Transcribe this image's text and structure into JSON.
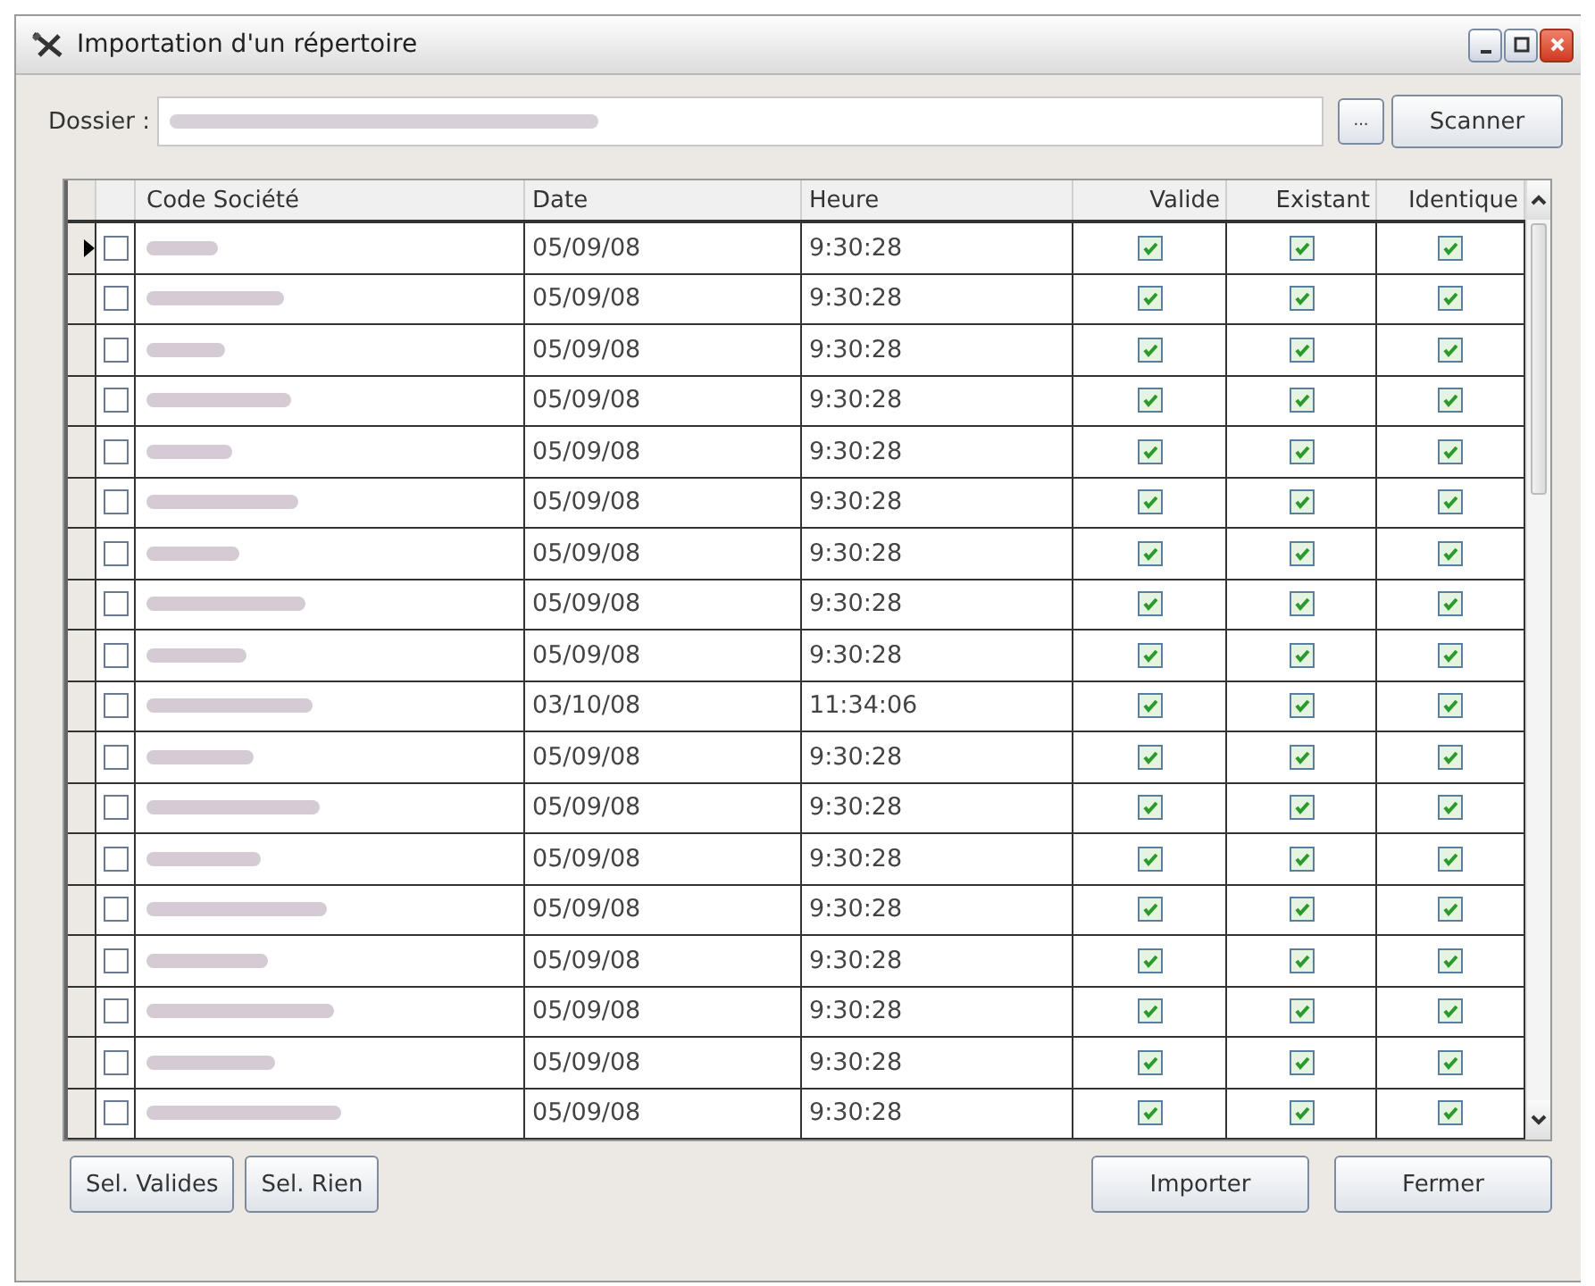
{
  "window": {
    "title": "Importation d'un répertoire"
  },
  "folder": {
    "label": "Dossier :",
    "browse_label": "...",
    "scan_label": "Scanner"
  },
  "table": {
    "columns": [
      "Code Société",
      "Date",
      "Heure",
      "Valide",
      "Existant",
      "Identique"
    ],
    "rows": [
      {
        "current": true,
        "checked": false,
        "date": "05/09/08",
        "time": "9:30:28",
        "valid": true,
        "existing": true,
        "identical": true
      },
      {
        "current": false,
        "checked": false,
        "date": "05/09/08",
        "time": "9:30:28",
        "valid": true,
        "existing": true,
        "identical": true
      },
      {
        "current": false,
        "checked": false,
        "date": "05/09/08",
        "time": "9:30:28",
        "valid": true,
        "existing": true,
        "identical": true
      },
      {
        "current": false,
        "checked": false,
        "date": "05/09/08",
        "time": "9:30:28",
        "valid": true,
        "existing": true,
        "identical": true
      },
      {
        "current": false,
        "checked": false,
        "date": "05/09/08",
        "time": "9:30:28",
        "valid": true,
        "existing": true,
        "identical": true
      },
      {
        "current": false,
        "checked": false,
        "date": "05/09/08",
        "time": "9:30:28",
        "valid": true,
        "existing": true,
        "identical": true
      },
      {
        "current": false,
        "checked": false,
        "date": "05/09/08",
        "time": "9:30:28",
        "valid": true,
        "existing": true,
        "identical": true
      },
      {
        "current": false,
        "checked": false,
        "date": "05/09/08",
        "time": "9:30:28",
        "valid": true,
        "existing": true,
        "identical": true
      },
      {
        "current": false,
        "checked": false,
        "date": "05/09/08",
        "time": "9:30:28",
        "valid": true,
        "existing": true,
        "identical": true
      },
      {
        "current": false,
        "checked": false,
        "date": "03/10/08",
        "time": "11:34:06",
        "valid": true,
        "existing": true,
        "identical": true
      },
      {
        "current": false,
        "checked": false,
        "date": "05/09/08",
        "time": "9:30:28",
        "valid": true,
        "existing": true,
        "identical": true
      },
      {
        "current": false,
        "checked": false,
        "date": "05/09/08",
        "time": "9:30:28",
        "valid": true,
        "existing": true,
        "identical": true
      },
      {
        "current": false,
        "checked": false,
        "date": "05/09/08",
        "time": "9:30:28",
        "valid": true,
        "existing": true,
        "identical": true
      },
      {
        "current": false,
        "checked": false,
        "date": "05/09/08",
        "time": "9:30:28",
        "valid": true,
        "existing": true,
        "identical": true
      },
      {
        "current": false,
        "checked": false,
        "date": "05/09/08",
        "time": "9:30:28",
        "valid": true,
        "existing": true,
        "identical": true
      },
      {
        "current": false,
        "checked": false,
        "date": "05/09/08",
        "time": "9:30:28",
        "valid": true,
        "existing": true,
        "identical": true
      },
      {
        "current": false,
        "checked": false,
        "date": "05/09/08",
        "time": "9:30:28",
        "valid": true,
        "existing": true,
        "identical": true
      },
      {
        "current": false,
        "checked": false,
        "date": "05/09/08",
        "time": "9:30:28",
        "valid": true,
        "existing": true,
        "identical": true
      }
    ]
  },
  "buttons_left": [
    "Sel. Valides",
    "Sel. Rien"
  ],
  "buttons_right": [
    "Importer",
    "Fermer"
  ]
}
